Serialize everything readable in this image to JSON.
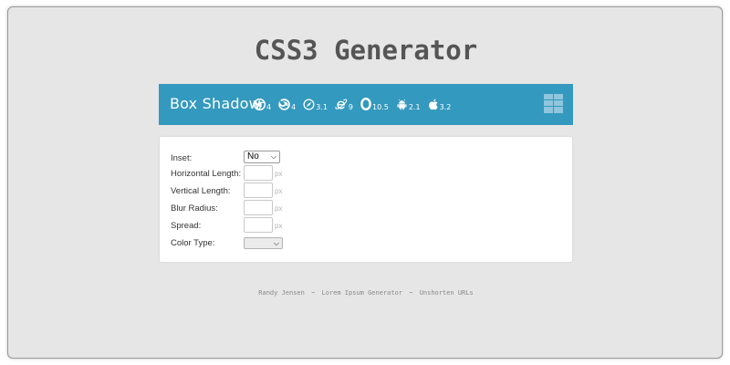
{
  "page": {
    "title": "CSS3 Generator"
  },
  "header": {
    "title": "Box Shadow",
    "browsers": [
      {
        "icon": "chrome-icon",
        "version": "4"
      },
      {
        "icon": "firefox-icon",
        "version": "4"
      },
      {
        "icon": "safari-icon",
        "version": "3.1"
      },
      {
        "icon": "ie-icon",
        "version": "9"
      },
      {
        "icon": "opera-icon",
        "version": "10.5"
      },
      {
        "icon": "android-icon",
        "version": "2.1"
      },
      {
        "icon": "apple-icon",
        "version": "3.2"
      }
    ],
    "menu_icon": "grid-icon"
  },
  "form": {
    "inset": {
      "label": "Inset:",
      "value": "No"
    },
    "horizontal_length": {
      "label": "Horizontal Length:",
      "value": "",
      "unit": "px"
    },
    "vertical_length": {
      "label": "Vertical Length:",
      "value": "",
      "unit": "px"
    },
    "blur_radius": {
      "label": "Blur Radius:",
      "value": "",
      "unit": "px"
    },
    "spread": {
      "label": "Spread:",
      "value": "",
      "unit": "px"
    },
    "color_type": {
      "label": "Color Type:",
      "value": ""
    }
  },
  "footer": {
    "links": [
      "Randy Jensen",
      "Lorem Ipsum Generator",
      "Unshorten URLs"
    ],
    "separator": "~"
  },
  "colors": {
    "background": "#e6e6e6",
    "header_bar": "#3499be",
    "title_text": "#555555",
    "panel": "#ffffff"
  }
}
